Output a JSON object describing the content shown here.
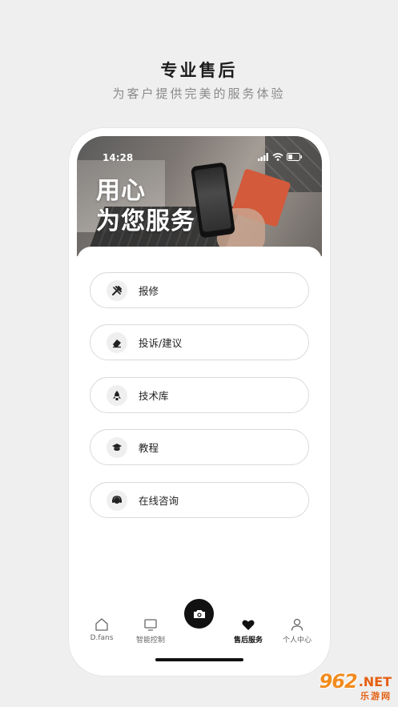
{
  "promo": {
    "title": "专业售后",
    "subtitle": "为客户提供完美的服务体验"
  },
  "status_bar": {
    "time": "14:28"
  },
  "hero": {
    "line1": "用心",
    "line2": "为您服务"
  },
  "menu": [
    {
      "label": "报修",
      "icon": "tools-icon"
    },
    {
      "label": "投诉/建议",
      "icon": "eraser-icon"
    },
    {
      "label": "技术库",
      "icon": "rocket-icon"
    },
    {
      "label": "教程",
      "icon": "graduation-cap-icon"
    },
    {
      "label": "在线咨询",
      "icon": "headset-icon"
    }
  ],
  "tabbar": {
    "tabs": [
      {
        "label": "D.fans",
        "icon": "home-icon"
      },
      {
        "label": "智能控制",
        "icon": "monitor-icon"
      },
      {
        "label": "售后服务",
        "icon": "heart-icon",
        "active": true
      },
      {
        "label": "个人中心",
        "icon": "person-icon"
      }
    ],
    "center_button_icon": "camera-icon"
  },
  "watermark": {
    "logo": "962",
    "suffix": ".NET",
    "sub": "乐游网"
  },
  "colors": {
    "background": "#efefef",
    "accent_dark": "#111111",
    "watermark_orange": "#f18b1d"
  }
}
